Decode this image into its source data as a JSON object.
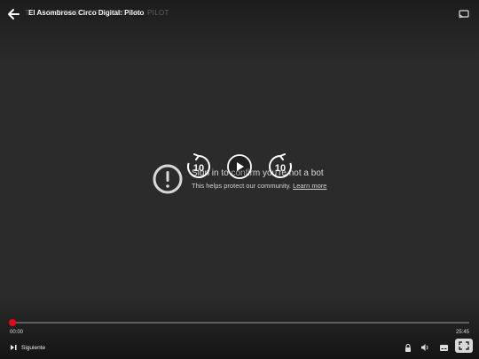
{
  "player": {
    "title": "El Asombroso Circo Digital: Piloto",
    "ghost_title": "TE ASOMBROSO CIRCO DIGITAL: PILOT",
    "accent": "#e50914",
    "background": "#2b2b2b"
  },
  "notice": {
    "heading": "Sign in to confirm you're not a bot",
    "body": "This helps protect our community.",
    "link": "Learn more"
  },
  "controls": {
    "rewind_seconds": "10",
    "forward_seconds": "10",
    "current_time": "00:00",
    "total_time": "25:45",
    "progress": 0.0,
    "next_label": "Siguiente",
    "icons": [
      "back-arrow-icon",
      "cast-icon",
      "rewind-10-icon",
      "play-icon",
      "forward-10-icon",
      "next-episode-icon",
      "lock-icon",
      "volume-icon",
      "subtitles-icon",
      "fullscreen-icon"
    ]
  }
}
